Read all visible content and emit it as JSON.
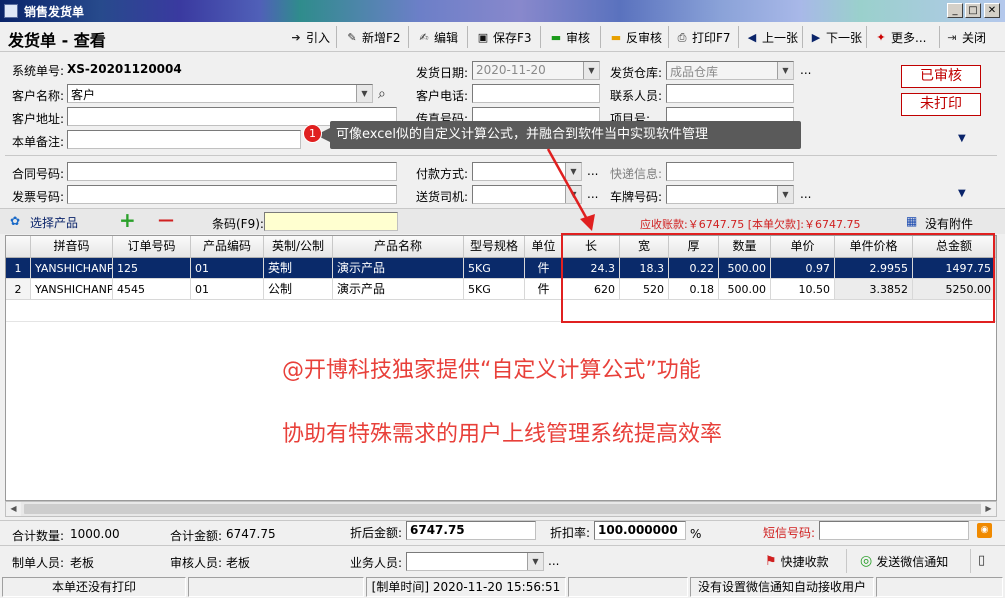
{
  "window": {
    "title": "销售发货单",
    "min_label": "_",
    "max_label": "□",
    "close_label": "✕"
  },
  "header": {
    "page_title": "发货单 - 查看"
  },
  "toolbar": {
    "import": "引入",
    "new": "新增F2",
    "edit": "编辑",
    "save": "保存F3",
    "approve": "审核",
    "unapprove": "反审核",
    "print": "打印F7",
    "prev": "上一张",
    "next": "下一张",
    "more": "更多...",
    "close": "关闭"
  },
  "form": {
    "sys_no_label": "系统单号:",
    "sys_no": "XS-20201120004",
    "date_label": "发货日期:",
    "date": "2020-11-20",
    "warehouse_label": "发货仓库:",
    "warehouse": "成品仓库",
    "customer_label": "客户名称:",
    "customer": "客户",
    "phone_label": "客户电话:",
    "phone": "",
    "contact_label": "联系人员:",
    "contact": "",
    "address_label": "客户地址:",
    "address": "",
    "fax_label": "传真号码:",
    "project_label": "项目号:",
    "remark_label": "本单备注:",
    "remark": "",
    "contract_label": "合同号码:",
    "contract": "",
    "payment_label": "付款方式:",
    "payment": "",
    "express_label": "快递信息:",
    "express": "",
    "invoice_label": "发票号码:",
    "invoice": "",
    "driver_label": "送货司机:",
    "driver": "",
    "plate_label": "车牌号码:",
    "plate": "",
    "ellipsis": "..."
  },
  "stamps": {
    "approved": "已审核",
    "unprinted": "未打印"
  },
  "tooltip": {
    "number": "1",
    "text": "可像excel似的自定义计算公式，并融合到软件当中实现软件管理"
  },
  "product_bar": {
    "select_label": "选择产品",
    "add_label": "+",
    "remove_label": "—",
    "barcode_label": "条码(F9):",
    "barcode": "",
    "receivable": "应收账款:￥6747.75 [本单欠款]:￥6747.75",
    "attachment": "没有附件"
  },
  "grid": {
    "columns": [
      "",
      "拼音码",
      "订单号码",
      "产品编码",
      "英制/公制",
      "产品名称",
      "型号规格",
      "单位",
      "长",
      "宽",
      "厚",
      "数量",
      "单价",
      "单件价格",
      "总金额"
    ],
    "rows": [
      [
        "1",
        "YANSHICHANP",
        "125",
        "01",
        "英制",
        "演示产品",
        "5KG",
        "件",
        "24.3",
        "18.3",
        "0.22",
        "500.00",
        "0.97",
        "2.9955",
        "1497.75"
      ],
      [
        "2",
        "YANSHICHANP",
        "4545",
        "01",
        "公制",
        "演示产品",
        "5KG",
        "件",
        "620",
        "520",
        "0.18",
        "500.00",
        "10.50",
        "3.3852",
        "5250.00"
      ]
    ]
  },
  "overlay": {
    "line1": "@开博科技独家提供“自定义计算公式”功能",
    "line2": "协助有特殊需求的用户上线管理系统提高效率"
  },
  "footer": {
    "total_qty_label": "合计数量:",
    "total_qty": "1000.00",
    "total_amt_label": "合计金额:",
    "total_amt": "6747.75",
    "discounted_label": "折后金额:",
    "discounted": "6747.75",
    "discount_rate_label": "折扣率:",
    "discount_rate": "100.000000",
    "percent": "%",
    "sms_label": "短信号码:",
    "sms": "",
    "maker_label": "制单人员:",
    "maker": "老板",
    "approver_label": "审核人员:",
    "approver": "老板",
    "sales_label": "业务人员:",
    "sales": "",
    "quick_collect": "快捷收款",
    "wechat_notify": "发送微信通知"
  },
  "status": {
    "print_status": "本单还没有打印",
    "created": "[制单时间] 2020-11-20 15:56:51",
    "wechat": "没有设置微信通知自动接收用户"
  },
  "colors": {
    "accent_red": "#e8403a",
    "selected_row": "#0a2a6a",
    "highlight_box": "#e02020"
  }
}
